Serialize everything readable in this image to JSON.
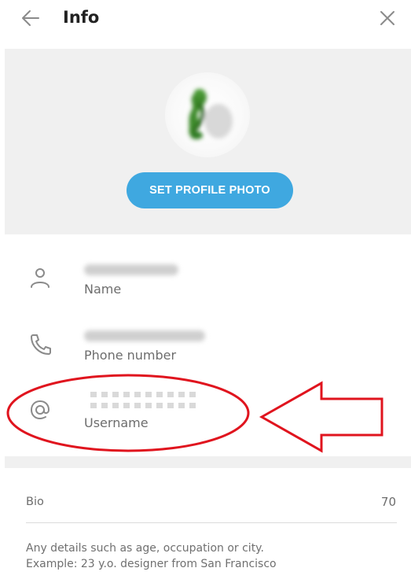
{
  "header": {
    "title": "Info"
  },
  "photo": {
    "button_label": "SET PROFILE PHOTO"
  },
  "fields": {
    "name": {
      "label": "Name",
      "icon": "user-icon"
    },
    "phone": {
      "label": "Phone number",
      "icon": "phone-icon"
    },
    "username": {
      "label": "Username",
      "icon": "at-sign-icon"
    }
  },
  "bio": {
    "label": "Bio",
    "remaining": "70",
    "hint_line1": "Any details such as age, occupation or city.",
    "hint_line2": "Example: 23 y.o. designer from San Francisco"
  },
  "colors": {
    "accent": "#3fa8e0",
    "annotation": "#e0141e"
  }
}
